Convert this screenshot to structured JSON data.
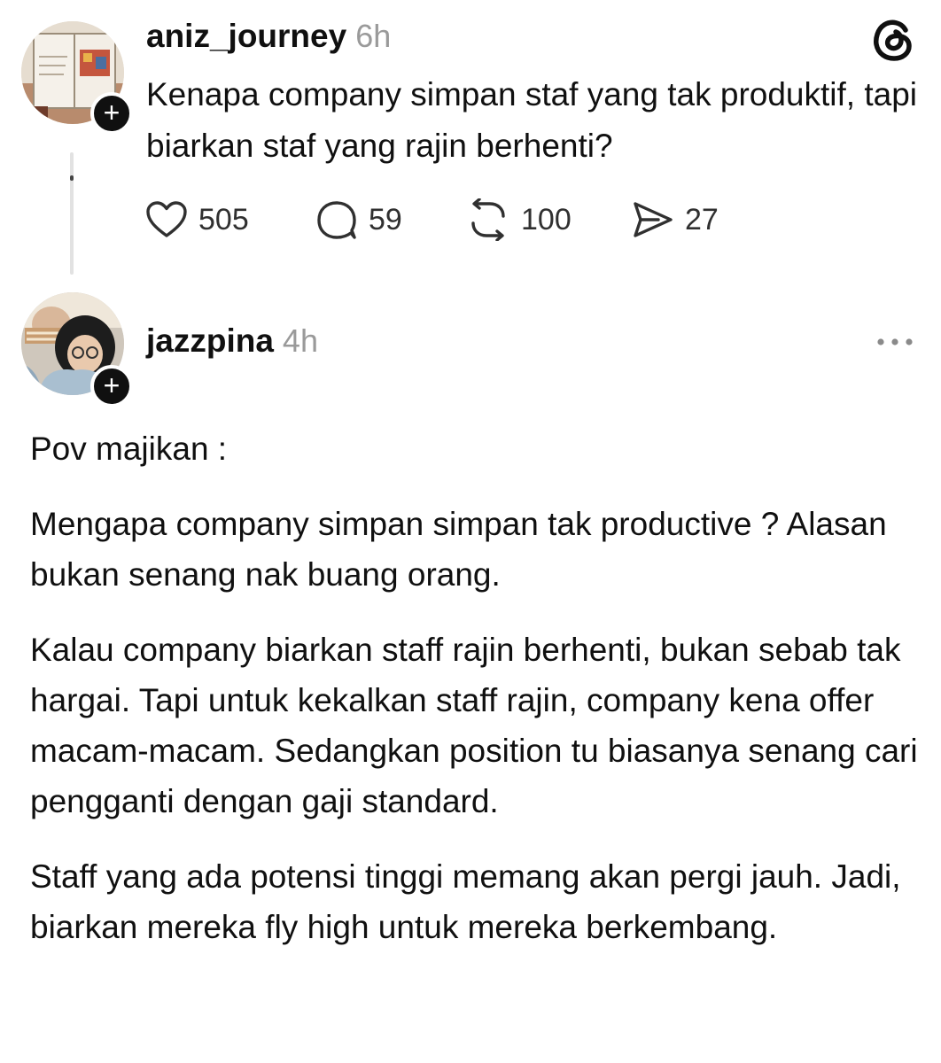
{
  "post1": {
    "username": "aniz_journey",
    "time": "6h",
    "text": "Kenapa company simpan staf yang tak produktif, tapi biarkan staf yang rajin berhenti?",
    "likes": "505",
    "replies": "59",
    "reposts": "100",
    "shares": "27"
  },
  "post2": {
    "username": "jazzpina",
    "time": "4h",
    "paragraphs": [
      "Pov majikan :",
      "Mengapa company simpan simpan tak productive ? Alasan bukan senang nak buang orang.",
      "Kalau company biarkan staff rajin berhenti, bukan sebab tak hargai. Tapi untuk kekalkan staff rajin, company kena offer macam-macam. Sedangkan position tu biasanya senang cari pengganti dengan gaji standard.",
      "Staff yang ada potensi tinggi memang akan pergi jauh. Jadi, biarkan mereka fly high untuk mereka berkembang."
    ]
  },
  "icons": {
    "follow": "+",
    "app_logo": "threads-logo-icon",
    "like": "heart-icon",
    "reply": "comment-icon",
    "repost": "repost-icon",
    "share": "send-icon",
    "more": "more-icon"
  }
}
